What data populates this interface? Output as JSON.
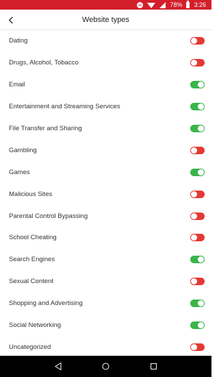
{
  "status_bar": {
    "battery_percent": "78%",
    "time": "3:26"
  },
  "header": {
    "title": "Website types",
    "back_icon": "chevron-left-icon"
  },
  "colors": {
    "status_bar": "#d21f2b",
    "toggle_on": "#39b54a",
    "toggle_off": "#e53935"
  },
  "items": [
    {
      "label": "Dating",
      "enabled": false
    },
    {
      "label": "Drugs, Alcohol, Tobacco",
      "enabled": false
    },
    {
      "label": "Email",
      "enabled": true
    },
    {
      "label": "Entertainment and Streaming Services",
      "enabled": true
    },
    {
      "label": "File Transfer and Sharing",
      "enabled": true
    },
    {
      "label": "Gambling",
      "enabled": false
    },
    {
      "label": "Games",
      "enabled": true
    },
    {
      "label": "Malicious Sites",
      "enabled": false
    },
    {
      "label": "Parental Control Bypassing",
      "enabled": false
    },
    {
      "label": "School Cheating",
      "enabled": false
    },
    {
      "label": "Search Engines",
      "enabled": true
    },
    {
      "label": "Sexual Content",
      "enabled": false
    },
    {
      "label": "Shopping and Advertising",
      "enabled": true
    },
    {
      "label": "Social Networking",
      "enabled": true
    },
    {
      "label": "Uncategorized",
      "enabled": false
    }
  ],
  "nav_bar": {
    "back_icon": "nav-back-icon",
    "home_icon": "nav-home-icon",
    "recents_icon": "nav-recents-icon"
  }
}
